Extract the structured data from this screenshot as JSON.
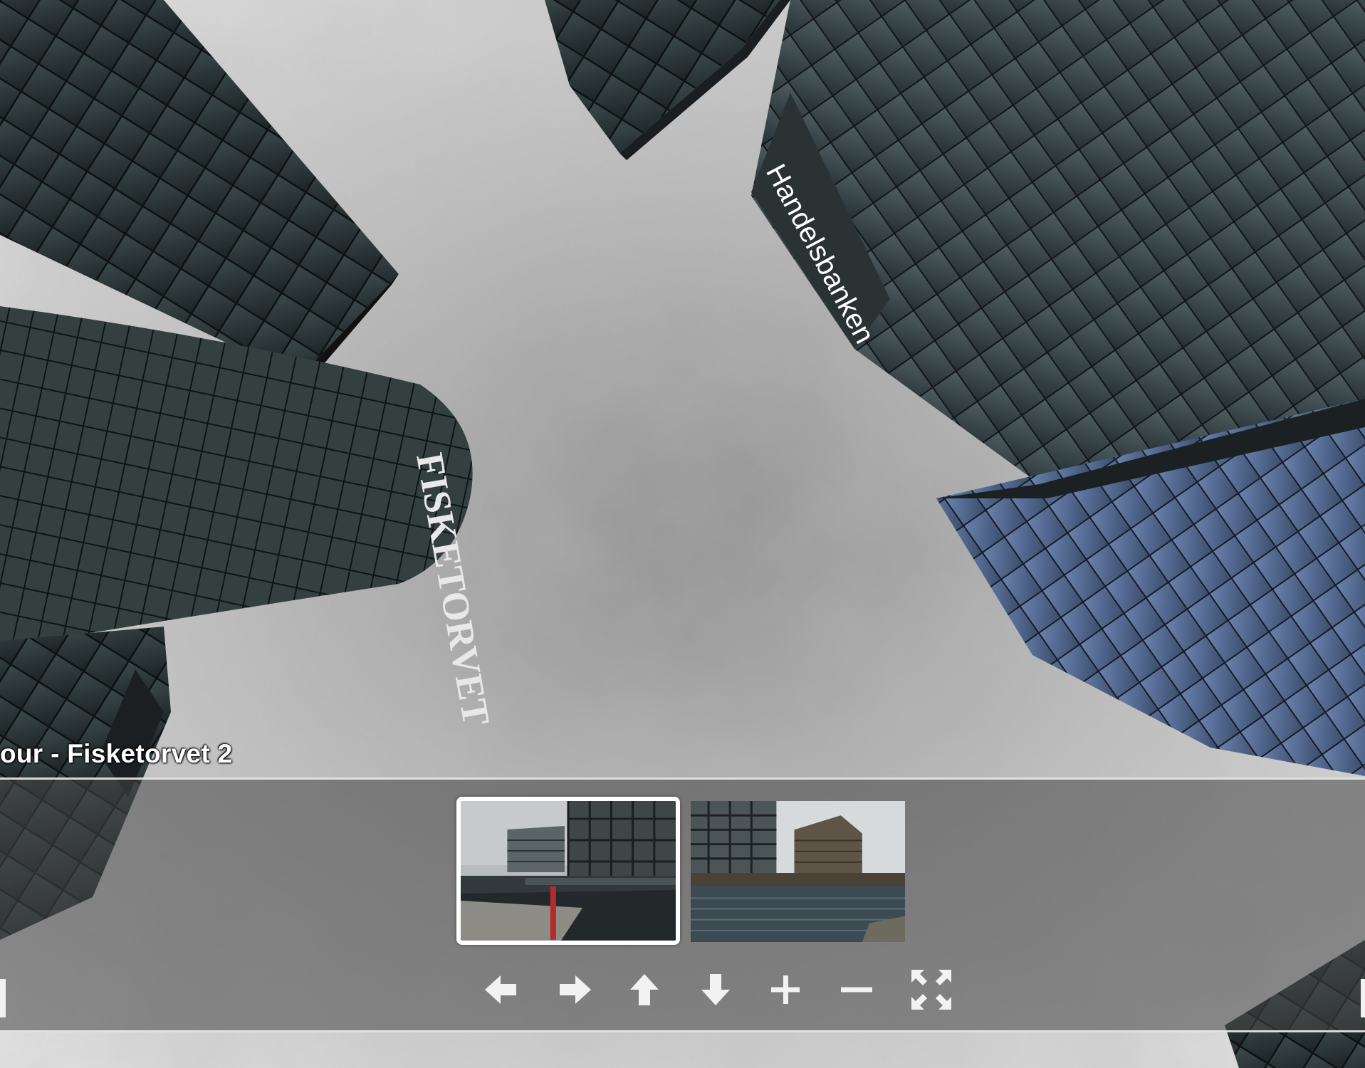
{
  "tour": {
    "title": "our - Fisketorvet 2"
  },
  "thumbnails": [
    {
      "label": "",
      "active": true
    },
    {
      "label": "",
      "active": false
    }
  ],
  "controls": {
    "left_icon": "arrow-left-icon",
    "right_icon": "arrow-right-icon",
    "up_icon": "arrow-up-icon",
    "down_icon": "arrow-down-icon",
    "zoom_in_icon": "plus-icon",
    "zoom_out_icon": "minus-icon",
    "fullscreen_icon": "fullscreen-icon"
  },
  "colors": {
    "bar_border": "#ebebeb",
    "icon": "#f2f2f2",
    "active_thumb_border": "#ffffff"
  }
}
